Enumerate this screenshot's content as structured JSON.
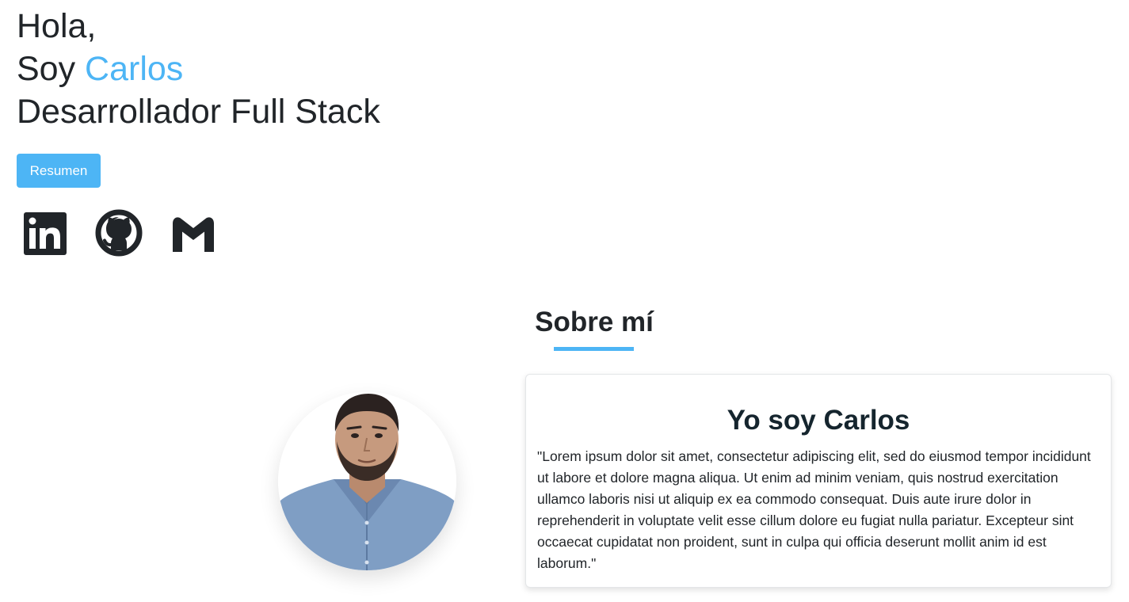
{
  "hero": {
    "greeting": "Hola,",
    "intro_prefix": "Soy ",
    "name": "Carlos",
    "role": "Desarrollador Full Stack",
    "resume_button": "Resumen"
  },
  "socials": [
    {
      "icon": "linkedin-icon"
    },
    {
      "icon": "github-icon"
    },
    {
      "icon": "gmail-icon"
    }
  ],
  "about": {
    "section_title": "Sobre mí",
    "card_title": "Yo soy Carlos",
    "card_text": "\"Lorem ipsum dolor sit amet, consectetur adipiscing elit, sed do eiusmod tempor incididunt ut labore et dolore magna aliqua. Ut enim ad minim veniam, quis nostrud exercitation ullamco laboris nisi ut aliquip ex ea commodo consequat. Duis aute irure dolor in reprehenderit in voluptate velit esse cillum dolore eu fugiat nulla pariatur. Excepteur sint occaecat cupidatat non proident, sunt in culpa qui officia deserunt mollit anim id est laborum.\""
  },
  "colors": {
    "accent": "#4db5f5",
    "text": "#212529",
    "card_title": "#15252e"
  }
}
